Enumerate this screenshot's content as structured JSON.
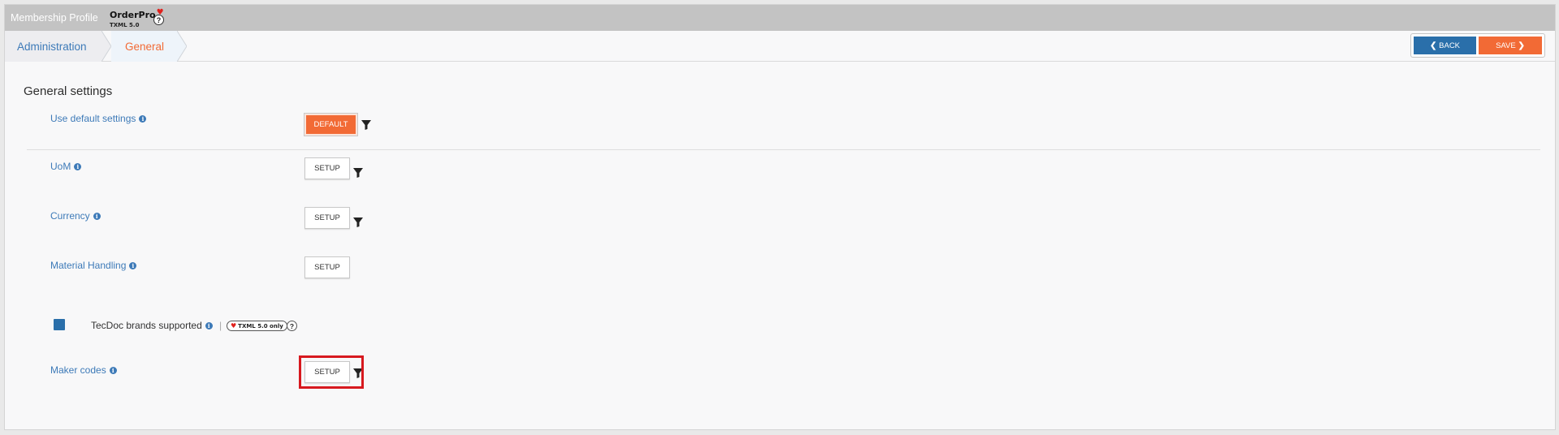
{
  "topbar": {
    "app_title": "Membership Profile",
    "brand_name": "OrderPro",
    "brand_version": "TXML 5.0",
    "help_icon": "?"
  },
  "breadcrumb": {
    "items": [
      {
        "label": "Administration"
      },
      {
        "label": "General"
      }
    ]
  },
  "actions": {
    "back_label": "BACK",
    "save_label": "SAVE",
    "back_icon": "chevron-left-icon",
    "save_icon": "chevron-right-icon"
  },
  "main": {
    "section_title": "General settings",
    "rows": [
      {
        "label": "Use default settings",
        "button": "DEFAULT"
      },
      {
        "label": "UoM",
        "button": "SETUP"
      },
      {
        "label": "Currency",
        "button": "SETUP"
      },
      {
        "label": "Material Handling",
        "button": "SETUP"
      },
      {
        "label": "Maker codes",
        "button": "SETUP"
      }
    ],
    "tecdoc": {
      "label": "TecDoc brands supported",
      "checked": true,
      "badge": "TXML 5.0 only",
      "help": "?"
    }
  },
  "colors": {
    "accent_orange": "#f26a35",
    "accent_blue": "#2a6faa",
    "link_blue": "#3d7ab8",
    "highlight_red": "#d7191f"
  }
}
